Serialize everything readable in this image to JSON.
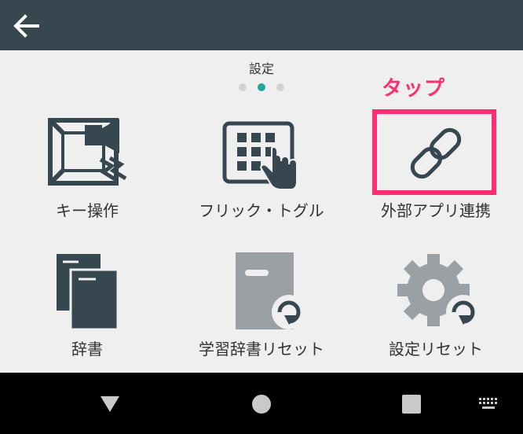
{
  "colors": {
    "app_bar": "#37474f",
    "content_bg": "#efefef",
    "icon_dark": "#37474f",
    "icon_gray": "#9aa0a3",
    "accent_dot": "#26a69a",
    "annotation": "#ff2d73",
    "nav_bg": "#000000"
  },
  "app_bar": {
    "back_icon": "arrow-left-icon"
  },
  "page": {
    "title": "設定",
    "page_indicator": {
      "count": 3,
      "active_index": 2
    }
  },
  "annotation": {
    "text": "タップ"
  },
  "tiles": [
    {
      "label": "キー操作",
      "icon": "key-operation-icon"
    },
    {
      "label": "フリック・トグル",
      "icon": "flick-toggle-icon"
    },
    {
      "label": "外部アプリ連携",
      "icon": "link-icon"
    },
    {
      "label": "辞書",
      "icon": "dictionary-icon"
    },
    {
      "label": "学習辞書リセット",
      "icon": "learning-dictionary-reset-icon"
    },
    {
      "label": "設定リセット",
      "icon": "settings-reset-icon"
    }
  ],
  "nav_bar": {
    "buttons": [
      "back-triangle-icon",
      "home-circle-icon",
      "recents-square-icon",
      "keyboard-icon"
    ]
  }
}
